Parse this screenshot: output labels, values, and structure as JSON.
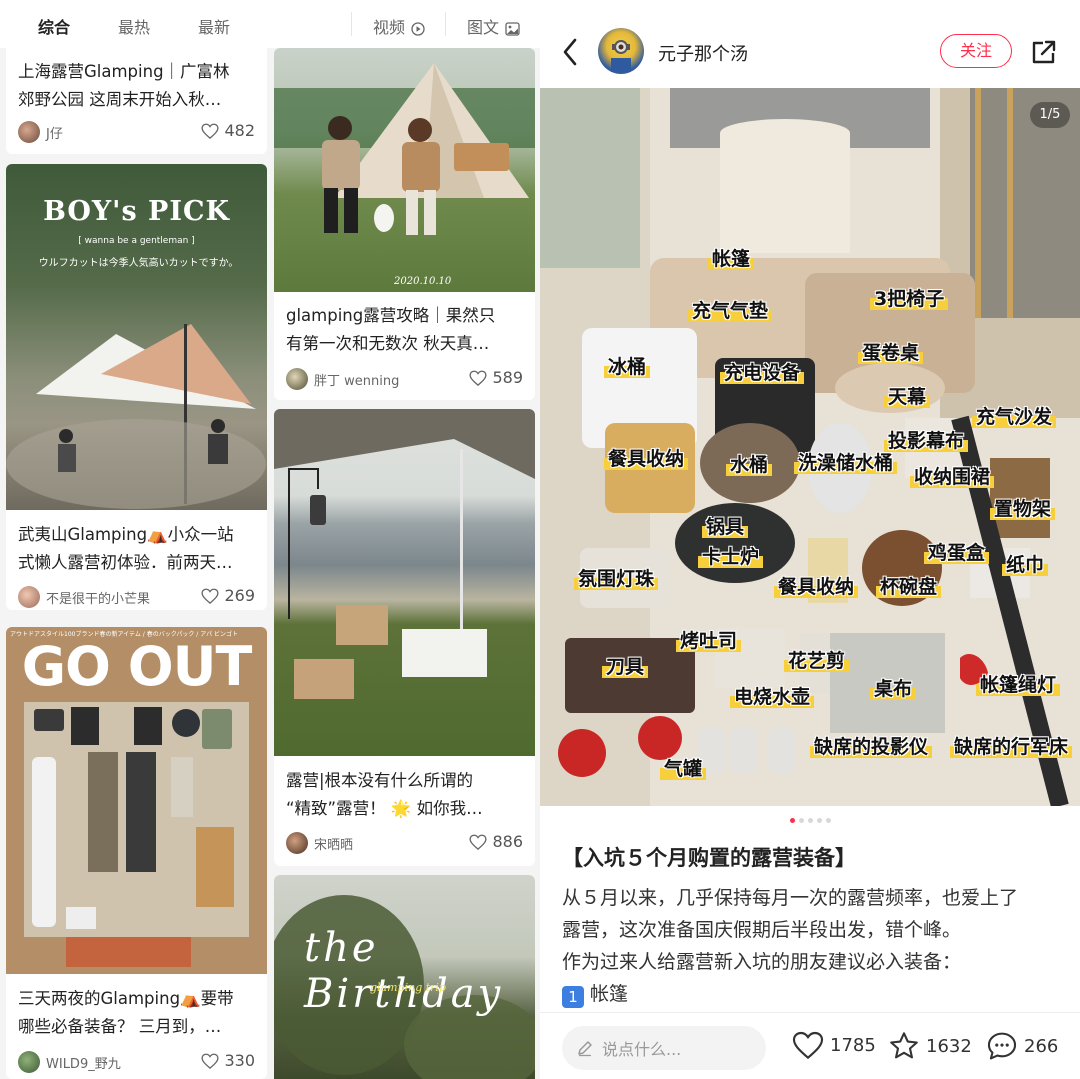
{
  "feed": {
    "tabs": [
      "综合",
      "最热",
      "最新"
    ],
    "filters": [
      {
        "label": "视频",
        "icon": "play-circle-icon"
      },
      {
        "label": "图文",
        "icon": "image-icon"
      }
    ],
    "cards": [
      {
        "title_lines": [
          "上海露营Glamping｜广富林",
          "郊野公园 这周末开始入秋…"
        ],
        "author": "J仔",
        "likes": "482"
      },
      {
        "image_text": [
          "BOY's PICK",
          "[ wanna be a gentleman ]",
          "ウルフカットは今季人気高いカットですか。"
        ],
        "title_lines": [
          "武夷山Glamping⛺小众一站",
          "式懒人露营初体验．前两天…"
        ],
        "author": "不是很干的小芒果",
        "likes": "269"
      },
      {
        "image_text": [
          "GO OUT",
          "アウトドアスタイル100ブランド春の新アイテム / 春のバックパック / アパ ビンゴト"
        ],
        "title_lines": [
          "三天两夜的Glamping⛺要带",
          "哪些必备装备？ 三月到，…"
        ],
        "author": "WILD9_野九",
        "likes": "330"
      },
      {
        "image_text": [
          "2020.10.10"
        ],
        "title_lines": [
          "glamping露营攻略｜果然只",
          "有第一次和无数次 秋天真…"
        ],
        "author": "胖丁 wenning",
        "likes": "589"
      },
      {
        "title_lines": [
          "露营|根本没有什么所谓的",
          "“精致”露营！ 🌟 如你我…"
        ],
        "author": "宋晒晒",
        "likes": "886"
      },
      {
        "image_text": [
          "the Birthday",
          "glamping trip"
        ]
      }
    ]
  },
  "post": {
    "author": "元子那个汤",
    "follow_label": "关注",
    "image_counter": "1/5",
    "image_tags": [
      "帐篷",
      "充气气垫",
      "3把椅子",
      "冰桶",
      "充电设备",
      "蛋卷桌",
      "天幕",
      "充气沙发",
      "投影幕布",
      "餐具收纳",
      "水桶",
      "洗澡储水桶",
      "收纳围裙",
      "置物架",
      "锅具",
      "卡士炉",
      "鸡蛋盒",
      "纸巾",
      "氛围灯珠",
      "餐具收纳",
      "杯碗盘",
      "烤吐司",
      "花艺剪",
      "刀具",
      "电烧水壶",
      "桌布",
      "帐篷绳灯",
      "气罐",
      "缺席的投影仪",
      "缺席的行军床"
    ],
    "title": "【入坑５个月购置的露营装备】",
    "body_lines": [
      "从５月以来，几乎保持每月一次的露营频率，也爱上了",
      "露营，这次准备国庆假期后半段出发，错个峰。",
      "作为过来人给露营新入坑的朋友建议必入装备："
    ],
    "list_item": {
      "badge": "1",
      "text": "帐篷"
    },
    "comment_placeholder": "说点什么...",
    "likes": "1785",
    "stars": "1632",
    "comments": "266"
  },
  "colors": {
    "accent": "#ff2e4d",
    "highlight": "#f6cf3a"
  }
}
